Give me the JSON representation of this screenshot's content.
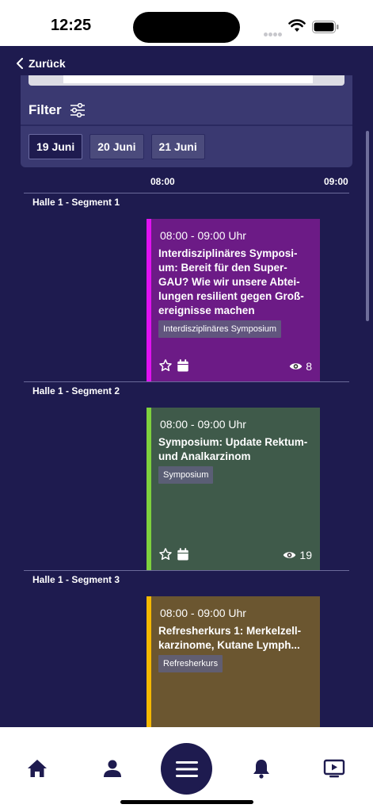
{
  "status_bar": {
    "time": "12:25"
  },
  "nav": {
    "back_label": "Zurück"
  },
  "filter": {
    "label": "Filter",
    "dates": [
      "19 Juni",
      "20 Juni",
      "21 Juni"
    ],
    "selected_date": "19 Juni"
  },
  "timeline": {
    "times": [
      "08:00",
      "09:00"
    ]
  },
  "segments": [
    {
      "label": "Halle 1 - Segment 1",
      "event": {
        "time": "08:00 - 09:00 Uhr",
        "title": "Interdisziplinäres Symposi-um: Bereit für den Super-GAU? Wie wir unsere Abtei-lungen resilient gegen Groß-ereignisse machen",
        "tag": "Interdisziplinäres Symposium",
        "views": "8",
        "card_color": "#6c1b86",
        "stripe_color": "#e012f0"
      }
    },
    {
      "label": "Halle 1 - Segment 2",
      "event": {
        "time": "08:00 - 09:00 Uhr",
        "title": "Symposium: Update Rektum-und Analkarzinom",
        "tag": "Symposium",
        "views": "19",
        "card_color": "#3f5a4a",
        "stripe_color": "#7ed13e"
      }
    },
    {
      "label": "Halle 1 - Segment 3",
      "event": {
        "time": "08:00 - 09:00 Uhr",
        "title": "Refresherkurs 1: Merkelzell-karzinome, Kutane Lymph...",
        "tag": "Refresherkurs",
        "card_color": "#6b5630",
        "stripe_color": "#f5b800"
      }
    }
  ],
  "bottom_nav": {
    "items": [
      "home-icon",
      "person-icon",
      "menu-icon",
      "bell-icon",
      "tv-play-icon"
    ]
  },
  "colors": {
    "background": "#1e1b4f",
    "panel": "#3a3971"
  }
}
